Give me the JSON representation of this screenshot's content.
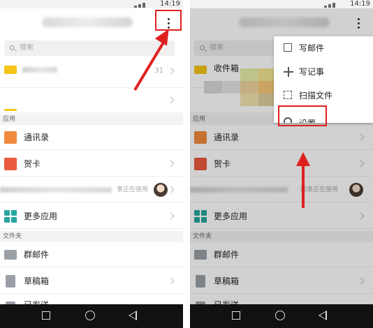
{
  "status_time": "14:19",
  "search_placeholder": "搜索",
  "left": {
    "inbox_count": "31",
    "section_apps": "应用",
    "contacts": "通讯录",
    "cards": "贺卡",
    "shared_note": "事正在使用",
    "more_apps": "更多应用",
    "section_folders": "文件夹",
    "group_mail": "群邮件",
    "drafts": "草稿箱",
    "partial_item": "已发送"
  },
  "right": {
    "menu": [
      "写邮件",
      "写记事",
      "扫描文件",
      "设置"
    ],
    "section_apps": "应用",
    "contacts": "通讯录",
    "cards": "贺卡",
    "shared_note": "同事正在使用",
    "more_apps": "更多应用",
    "section_folders": "文件夹",
    "group_mail": "群邮件",
    "drafts": "草稿箱",
    "partial_item": "已发送",
    "partial_inbox": "收件箱"
  },
  "colors": {
    "accent_red": "#e02020",
    "inbox_icon": "#f5c518",
    "contacts_icon": "#f08a3c",
    "cards_icon": "#ea5a3c",
    "apps_icon": "#26a6a0"
  },
  "icons": [
    "more-vertical-icon",
    "search-icon",
    "inbox-icon",
    "contacts-icon",
    "card-icon",
    "apps-grid-icon",
    "folder-icon",
    "draft-icon",
    "compose-icon",
    "plus-icon",
    "scan-icon",
    "gear-icon",
    "chevron-right-icon"
  ]
}
